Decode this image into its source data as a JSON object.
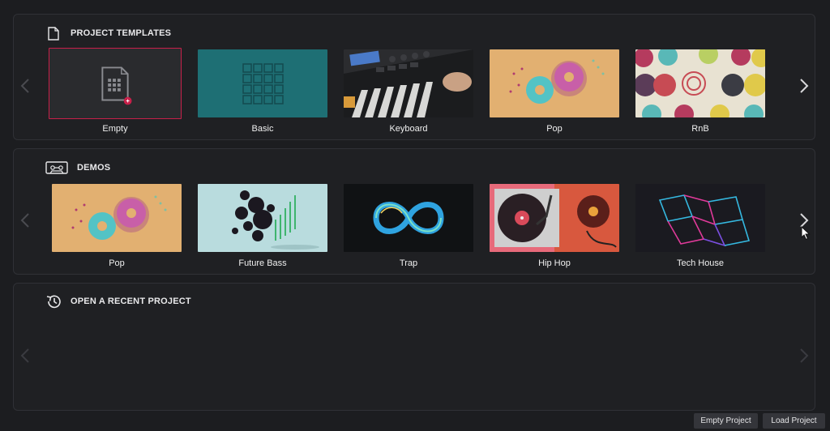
{
  "sections": {
    "templates": {
      "title": "PROJECT TEMPLATES",
      "items": [
        {
          "label": "Empty",
          "selected": true
        },
        {
          "label": "Basic"
        },
        {
          "label": "Keyboard"
        },
        {
          "label": "Pop"
        },
        {
          "label": "RnB"
        }
      ]
    },
    "demos": {
      "title": "DEMOS",
      "items": [
        {
          "label": "Pop"
        },
        {
          "label": "Future Bass"
        },
        {
          "label": "Trap"
        },
        {
          "label": "Hip Hop"
        },
        {
          "label": "Tech House"
        }
      ]
    },
    "recent": {
      "title": "OPEN A RECENT PROJECT"
    }
  },
  "footer": {
    "empty_project": "Empty Project",
    "load_project": "Load Project"
  },
  "colors": {
    "accent": "#c8204a",
    "teal": "#1e6f74",
    "panel": "#1f2023"
  }
}
